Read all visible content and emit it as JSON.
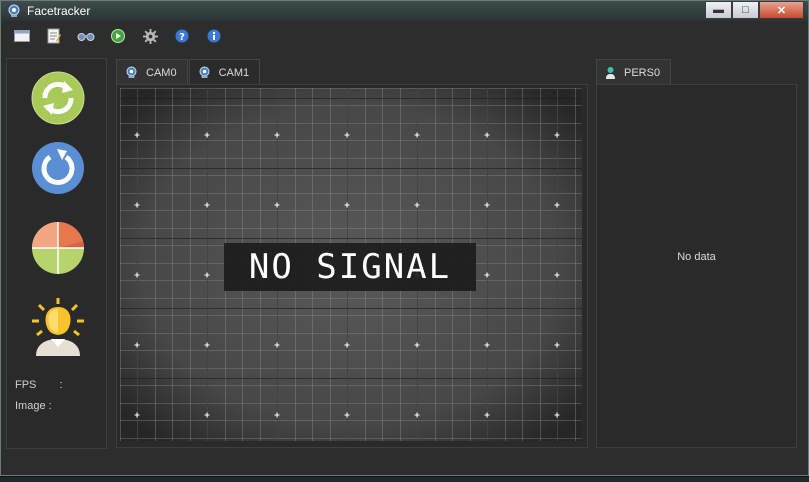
{
  "window": {
    "title": "Facetracker"
  },
  "toolbar": {
    "items": [
      {
        "icon": "window-icon"
      },
      {
        "icon": "notepad-icon"
      },
      {
        "icon": "binoculars-icon"
      },
      {
        "icon": "play-icon"
      },
      {
        "icon": "gear-icon"
      },
      {
        "icon": "help-icon"
      },
      {
        "icon": "info-icon"
      }
    ]
  },
  "left_panel": {
    "buttons": [
      {
        "icon": "sync-icon"
      },
      {
        "icon": "refresh-icon"
      },
      {
        "icon": "pie-chart-icon"
      },
      {
        "icon": "person-lightbulb-icon"
      }
    ],
    "fps_label": "FPS",
    "fps_sep": ":",
    "image_label": "Image :"
  },
  "camera": {
    "tabs": [
      {
        "label": "CAM0",
        "active": true
      },
      {
        "label": "CAM1",
        "active": false
      }
    ],
    "signal_text": "NO SIGNAL"
  },
  "persons": {
    "tabs": [
      {
        "label": "PERS0",
        "active": true
      }
    ],
    "empty_text": "No data"
  },
  "colors": {
    "window_bg": "#2d2d2d",
    "panel_bg": "#2a2a2a",
    "sync_green": "#a9c959",
    "refresh_blue": "#5b8fd4",
    "person_yellow": "#f6c42a"
  }
}
